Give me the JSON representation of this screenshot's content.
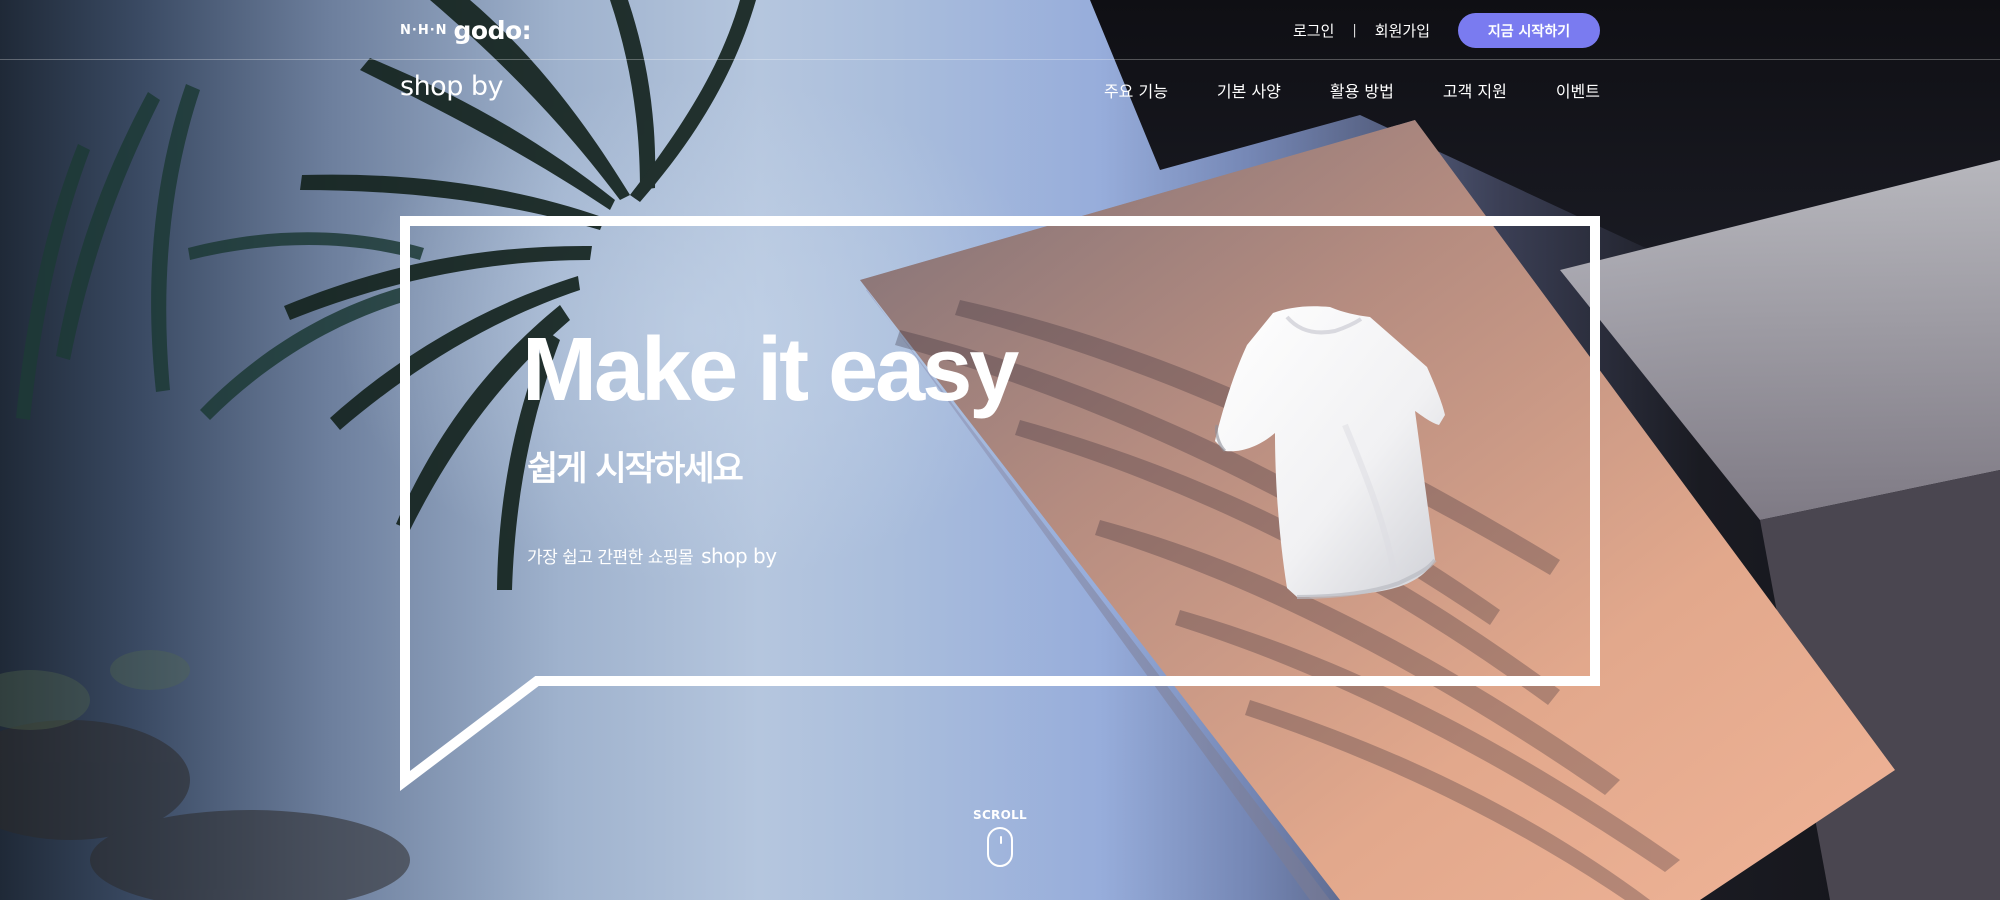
{
  "header": {
    "company_logo": {
      "prefix": "N·H·N",
      "name": "godo:"
    },
    "login_label": "로그인",
    "separator": "|",
    "signup_label": "회원가입",
    "start_button_label": "지금 시작하기",
    "accent_color": "#7a7bf0"
  },
  "nav": {
    "brand": "shop by",
    "items": [
      {
        "label": "주요 기능"
      },
      {
        "label": "기본 사양"
      },
      {
        "label": "활용 방법"
      },
      {
        "label": "고객 지원"
      },
      {
        "label": "이벤트"
      }
    ]
  },
  "hero": {
    "headline": "Make it easy",
    "sub_headline": "쉽게 시작하세요",
    "description": "가장 쉽고 간편한 쇼핑몰",
    "description_brand": "shop by"
  },
  "scroll": {
    "label": "SCROLL",
    "icon": "mouse-icon"
  }
}
